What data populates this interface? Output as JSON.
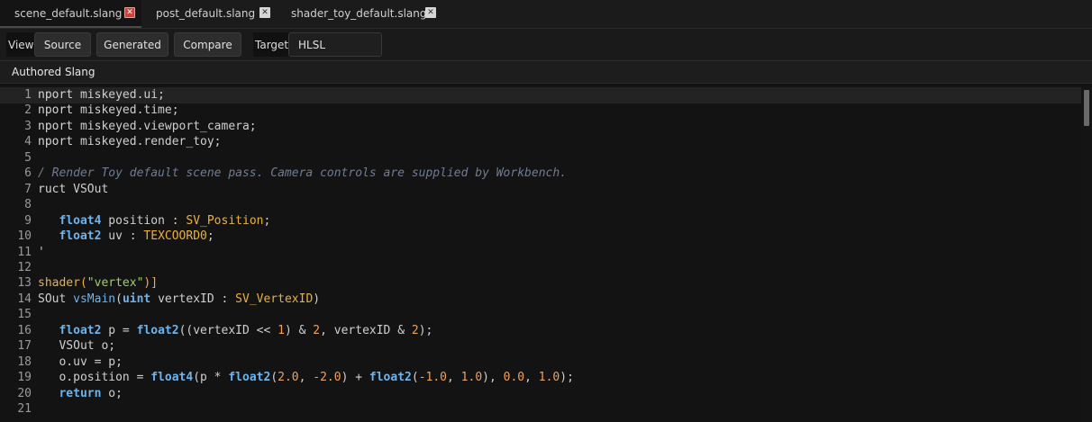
{
  "tabs": [
    {
      "label": "scene_default.slang",
      "active": true
    },
    {
      "label": "post_default.slang",
      "active": false
    },
    {
      "label": "shader_toy_default.slang",
      "active": false
    }
  ],
  "toolbar": {
    "view_label": "View",
    "source_button": "Source",
    "generated_button": "Generated",
    "compare_button": "Compare",
    "target_label": "Target",
    "target_value": "HLSL"
  },
  "section": {
    "title": "Authored Slang"
  },
  "colors": {
    "close_active": "#c8443c",
    "keyword_type": "#6cb4ee",
    "number": "#f0a25a",
    "semantic": "#e8b23c",
    "string": "#9fd068",
    "comment": "#6f7c94"
  },
  "editor": {
    "current_line": 1,
    "lines": [
      {
        "n": "1",
        "tokens": [
          [
            "kw",
            "nport"
          ],
          [
            "op",
            " miskeyed.ui;"
          ]
        ]
      },
      {
        "n": "2",
        "tokens": [
          [
            "kw",
            "nport"
          ],
          [
            "op",
            " miskeyed.time;"
          ]
        ]
      },
      {
        "n": "3",
        "tokens": [
          [
            "kw",
            "nport"
          ],
          [
            "op",
            " miskeyed.viewport_camera;"
          ]
        ]
      },
      {
        "n": "4",
        "tokens": [
          [
            "kw",
            "nport"
          ],
          [
            "op",
            " miskeyed.render_toy;"
          ]
        ]
      },
      {
        "n": "5",
        "tokens": []
      },
      {
        "n": "6",
        "tokens": [
          [
            "cm",
            "/ Render Toy default scene pass. Camera controls are supplied by Workbench."
          ]
        ]
      },
      {
        "n": "7",
        "tokens": [
          [
            "kw",
            "ruct"
          ],
          [
            "op",
            " VSOut"
          ]
        ]
      },
      {
        "n": "8",
        "tokens": []
      },
      {
        "n": "9",
        "tokens": [
          [
            "op",
            "   "
          ],
          [
            "ty",
            "float4"
          ],
          [
            "op",
            " position : "
          ],
          [
            "sem",
            "SV_Position"
          ],
          [
            "op",
            ";"
          ]
        ]
      },
      {
        "n": "10",
        "tokens": [
          [
            "op",
            "   "
          ],
          [
            "ty",
            "float2"
          ],
          [
            "op",
            " uv : "
          ],
          [
            "sem",
            "TEXCOORD0"
          ],
          [
            "op",
            ";"
          ]
        ]
      },
      {
        "n": "11",
        "tokens": [
          [
            "op",
            "'"
          ]
        ]
      },
      {
        "n": "12",
        "tokens": []
      },
      {
        "n": "13",
        "tokens": [
          [
            "attr",
            "shader("
          ],
          [
            "str",
            "\"vertex\""
          ],
          [
            "attr",
            ")]"
          ]
        ]
      },
      {
        "n": "14",
        "tokens": [
          [
            "op",
            "SOut "
          ],
          [
            "fn",
            "vsMain"
          ],
          [
            "op",
            "("
          ],
          [
            "ty",
            "uint"
          ],
          [
            "op",
            " vertexID : "
          ],
          [
            "sem",
            "SV_VertexID"
          ],
          [
            "op",
            ")"
          ]
        ]
      },
      {
        "n": "15",
        "tokens": []
      },
      {
        "n": "16",
        "tokens": [
          [
            "op",
            "   "
          ],
          [
            "ty",
            "float2"
          ],
          [
            "op",
            " p = "
          ],
          [
            "ty",
            "float2"
          ],
          [
            "op",
            "((vertexID << "
          ],
          [
            "num",
            "1"
          ],
          [
            "op",
            ") & "
          ],
          [
            "num",
            "2"
          ],
          [
            "op",
            ", vertexID & "
          ],
          [
            "num",
            "2"
          ],
          [
            "op",
            ");"
          ]
        ]
      },
      {
        "n": "17",
        "tokens": [
          [
            "op",
            "   VSOut o;"
          ]
        ]
      },
      {
        "n": "18",
        "tokens": [
          [
            "op",
            "   o.uv = p;"
          ]
        ]
      },
      {
        "n": "19",
        "tokens": [
          [
            "op",
            "   o.position = "
          ],
          [
            "ty",
            "float4"
          ],
          [
            "op",
            "(p * "
          ],
          [
            "ty",
            "float2"
          ],
          [
            "op",
            "("
          ],
          [
            "num",
            "2.0"
          ],
          [
            "op",
            ", "
          ],
          [
            "num",
            "-2.0"
          ],
          [
            "op",
            ") + "
          ],
          [
            "ty",
            "float2"
          ],
          [
            "op",
            "("
          ],
          [
            "num",
            "-1.0"
          ],
          [
            "op",
            ", "
          ],
          [
            "num",
            "1.0"
          ],
          [
            "op",
            "), "
          ],
          [
            "num",
            "0.0"
          ],
          [
            "op",
            ", "
          ],
          [
            "num",
            "1.0"
          ],
          [
            "op",
            ");"
          ]
        ]
      },
      {
        "n": "20",
        "tokens": [
          [
            "op",
            "   "
          ],
          [
            "ty",
            "return"
          ],
          [
            "op",
            " o;"
          ]
        ]
      },
      {
        "n": "21",
        "tokens": []
      }
    ]
  }
}
